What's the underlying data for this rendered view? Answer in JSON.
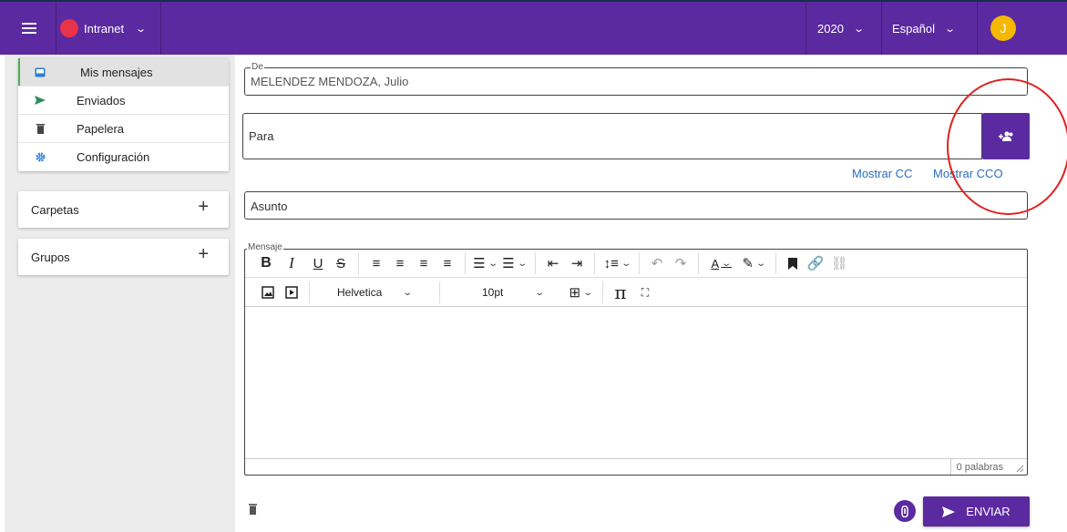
{
  "topbar": {
    "org_label": "Intranet",
    "year": "2020",
    "language": "Español",
    "avatar_initial": "J",
    "icons": [
      "hamburger-icon",
      "chevron-down-icon"
    ]
  },
  "sidebar": {
    "items": [
      {
        "label": "Mis mensajes",
        "icon": "inbox-icon",
        "active": true
      },
      {
        "label": "Enviados",
        "icon": "send-icon"
      },
      {
        "label": "Papelera",
        "icon": "trash-icon"
      },
      {
        "label": "Configuración",
        "icon": "gear-icon"
      }
    ],
    "folders_label": "Carpetas",
    "groups_label": "Grupos"
  },
  "compose": {
    "from_legend": "De",
    "from_value": "MELENDEZ MENDOZA, Julio",
    "to_placeholder": "Para",
    "show_cc": "Mostrar CC",
    "show_cco": "Mostrar CCO",
    "subject_placeholder": "Asunto",
    "message_legend": "Mensaje",
    "font_family": "Helvetica",
    "font_size": "10pt",
    "word_count": "0 palabras",
    "send_label": "ENVIAR"
  },
  "colors": {
    "primary": "#5b2aa0",
    "org_dot": "#e8334a",
    "avatar": "#f5b800",
    "link": "#2a6fbf",
    "active_indicator": "#4caf50",
    "annotation": "#e02020"
  }
}
